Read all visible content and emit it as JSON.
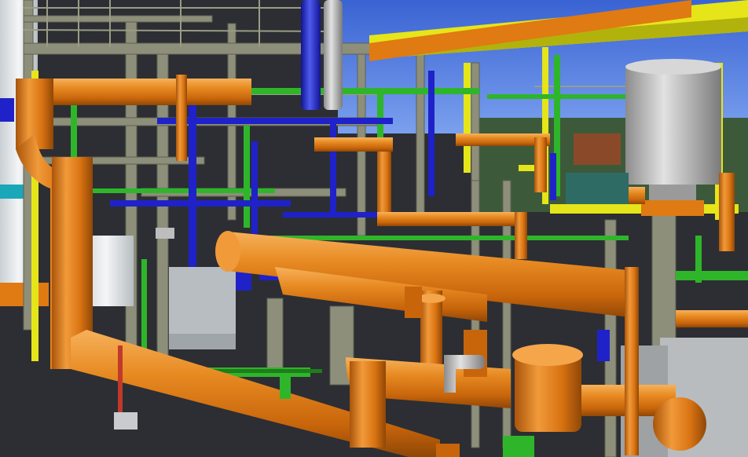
{
  "scene": {
    "description_free": true,
    "colors": {
      "sky": "#3f6fd6",
      "sky_light": "#6f95e8",
      "floor": "#2b2d31",
      "structure": "#8d8f7a",
      "structure_dark": "#6c6e5d",
      "orange_pipe": "#e07a12",
      "orange_light": "#f5a54a",
      "orange_dark": "#a9540a",
      "yellow_pipe": "#e5e51a",
      "yellow_dark": "#b2b20c",
      "blue_pipe": "#1f22c8",
      "blue_light": "#4e5af0",
      "green_pipe": "#2fb52a",
      "green_dark": "#1e7d1b",
      "grey_vessel": "#bdbdbd",
      "grey_dark": "#8a8a8a",
      "white_tank": "#e8ecef",
      "cyan_accent": "#19a7b9",
      "red_line": "#c0392b"
    }
  }
}
